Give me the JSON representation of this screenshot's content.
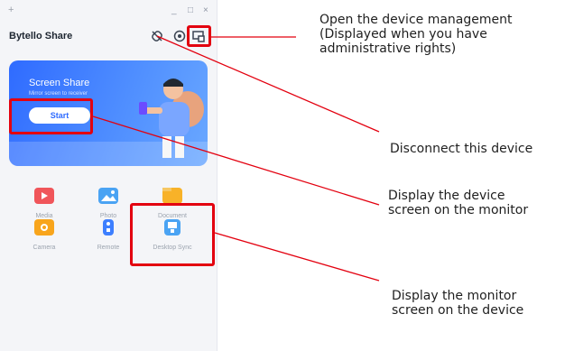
{
  "app": {
    "title": "Bytello Share",
    "titlebar": {
      "minimize": "_",
      "maximize": "□",
      "close": "×",
      "new": "+"
    }
  },
  "screen_share_card": {
    "title": "Screen Share",
    "subtitle": "Mirror screen to receiver",
    "start_label": "Start"
  },
  "features": [
    {
      "label": "Media",
      "icon": "media-icon",
      "color": "#f0555a"
    },
    {
      "label": "Photo",
      "icon": "photo-icon",
      "color": "#4aa3f3"
    },
    {
      "label": "Document",
      "icon": "document-icon",
      "color": "#f8b228"
    },
    {
      "label": "Camera",
      "icon": "camera-icon",
      "color": "#f8a51c"
    },
    {
      "label": "Remote",
      "icon": "remote-icon",
      "color": "#3d7fff"
    },
    {
      "label": "Desktop Sync",
      "icon": "desktop-sync-icon",
      "color": "#4aa3f3"
    }
  ],
  "annotations": {
    "device_management": "Open the device management\n(Displayed when you have\nadministrative rights)",
    "disconnect": "Disconnect this device",
    "display_on_monitor": "Display the device\nscreen on the monitor",
    "display_on_device": "Display the monitor\nscreen on the device"
  },
  "colors": {
    "accent": "#2f6bff",
    "highlight": "#e3000f"
  }
}
